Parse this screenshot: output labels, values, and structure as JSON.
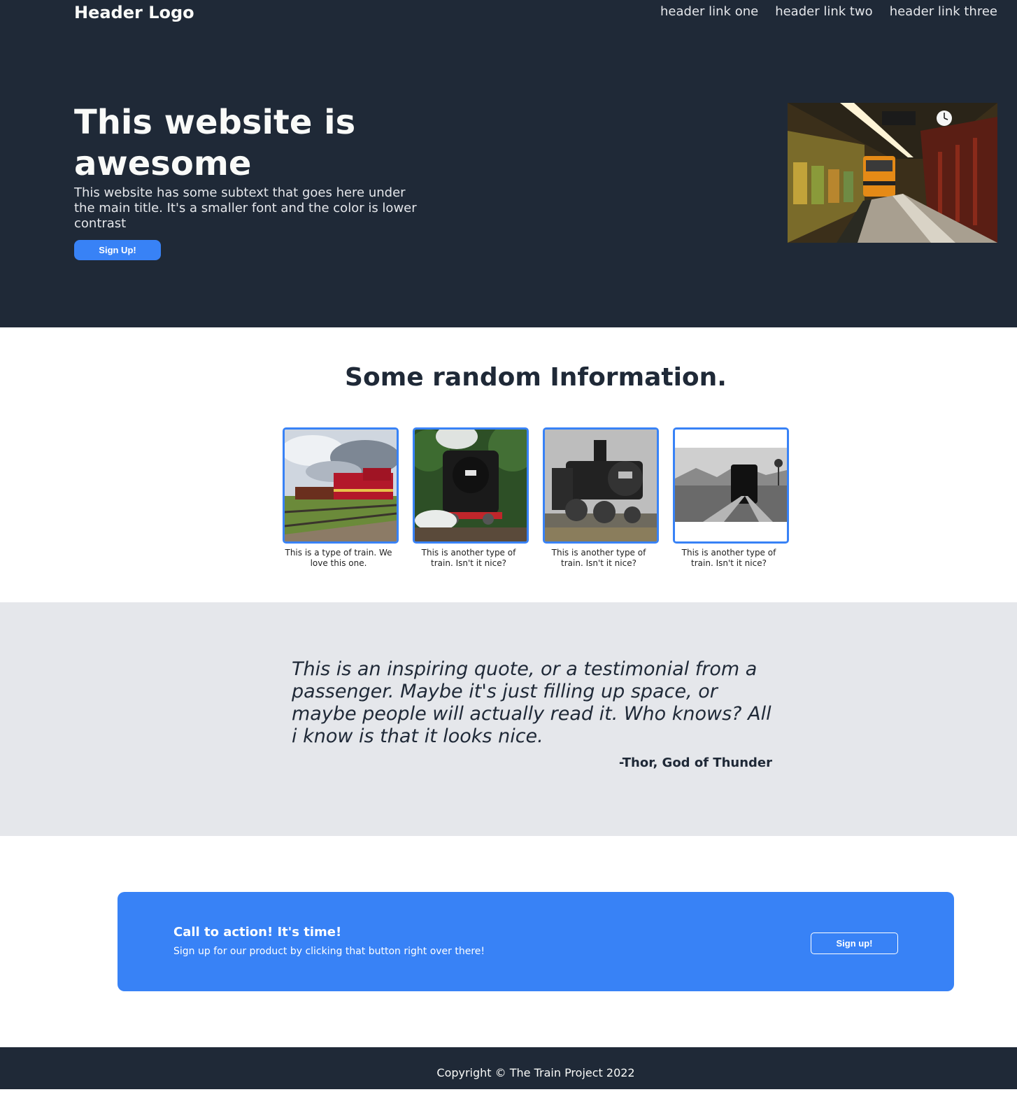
{
  "header": {
    "logo": "Header Logo",
    "links": [
      "header link one",
      "header link two",
      "header link three"
    ]
  },
  "hero": {
    "title": "This website is awesome",
    "subtext": "This website has some subtext that goes here under the main title. It's a smaller font and the color is lower contrast",
    "button_label": "Sign Up!",
    "image": "subway-station-photo"
  },
  "info": {
    "title": "Some random Information.",
    "cards": [
      {
        "caption": "This is a type of train. We love this one.",
        "image": "red-diesel-locomotive-photo"
      },
      {
        "caption": "This is another type of train. Isn't it nice?",
        "image": "steam-locomotive-photo"
      },
      {
        "caption": "This is another type of train. Isn't it nice?",
        "image": "bw-steam-locomotive-photo"
      },
      {
        "caption": "This is another type of train. Isn't it nice?",
        "image": "bw-train-silhouette-photo"
      }
    ]
  },
  "quote": {
    "text": "This is an inspiring quote, or a testimonial from a passenger. Maybe it's just filling up space, or maybe people will actually read it. Who knows? All i know is that it looks nice.",
    "author": "-Thor, God of Thunder"
  },
  "cta": {
    "title": "Call to action! It's time!",
    "subtext": "Sign up for our product by clicking that button right over there!",
    "button_label": "Sign up!"
  },
  "footer": {
    "copyright": "Copyright © The Train Project 2022"
  },
  "colors": {
    "dark": "#1f2937",
    "accent": "#3882f6",
    "light_gray": "#e5e7eb"
  }
}
